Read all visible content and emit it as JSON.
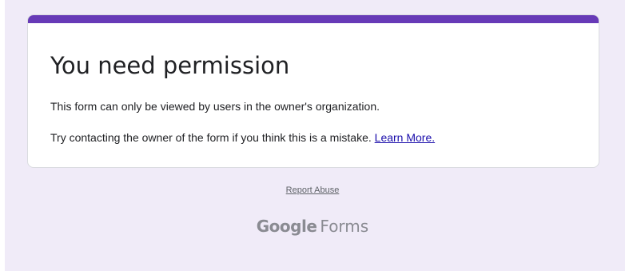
{
  "card": {
    "title": "You need permission",
    "message_1": "This form can only be viewed by users in the owner's organization.",
    "message_2": "Try contacting the owner of the form if you think this is a mistake. ",
    "learn_more_label": "Learn More."
  },
  "footer": {
    "report_abuse_label": "Report Abuse",
    "logo_google": "Google",
    "logo_product": "Forms"
  },
  "colors": {
    "accent": "#673ab7",
    "page_background": "#f0ebf8",
    "link": "#1a0dab"
  }
}
